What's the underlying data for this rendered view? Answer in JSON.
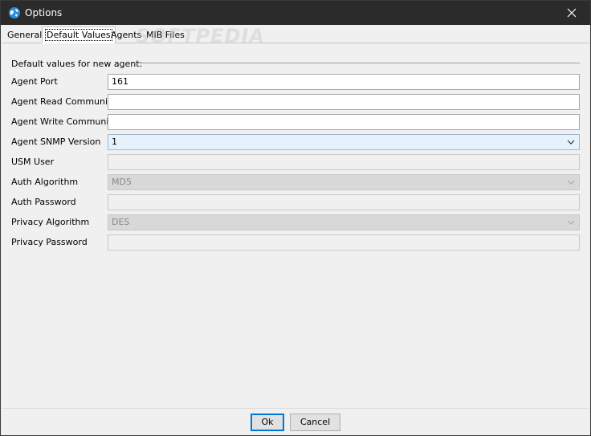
{
  "window": {
    "title": "Options"
  },
  "icons": {
    "app": "globe-icon",
    "close": "close-icon",
    "chevron": "chevron-down-icon"
  },
  "tabs": [
    {
      "label": "General"
    },
    {
      "label": "Default Values",
      "active": true
    },
    {
      "label": "Agents"
    },
    {
      "label": "MIB Files"
    }
  ],
  "group": {
    "title": "Default values for new agent:"
  },
  "fields": {
    "agent_port": {
      "label": "Agent Port",
      "value": "161"
    },
    "agent_read_community": {
      "label": "Agent Read Community",
      "value": ""
    },
    "agent_write_community": {
      "label": "Agent Write Community",
      "value": ""
    },
    "agent_snmp_version": {
      "label": "Agent SNMP Version",
      "value": "1"
    },
    "usm_user": {
      "label": "USM User",
      "value": ""
    },
    "auth_algorithm": {
      "label": "Auth Algorithm",
      "value": "MD5"
    },
    "auth_password": {
      "label": "Auth Password",
      "value": ""
    },
    "privacy_algorithm": {
      "label": "Privacy Algorithm",
      "value": "DES"
    },
    "privacy_password": {
      "label": "Privacy Password",
      "value": ""
    }
  },
  "buttons": {
    "ok": "Ok",
    "cancel": "Cancel"
  },
  "watermark": "SOFTPEDIA"
}
